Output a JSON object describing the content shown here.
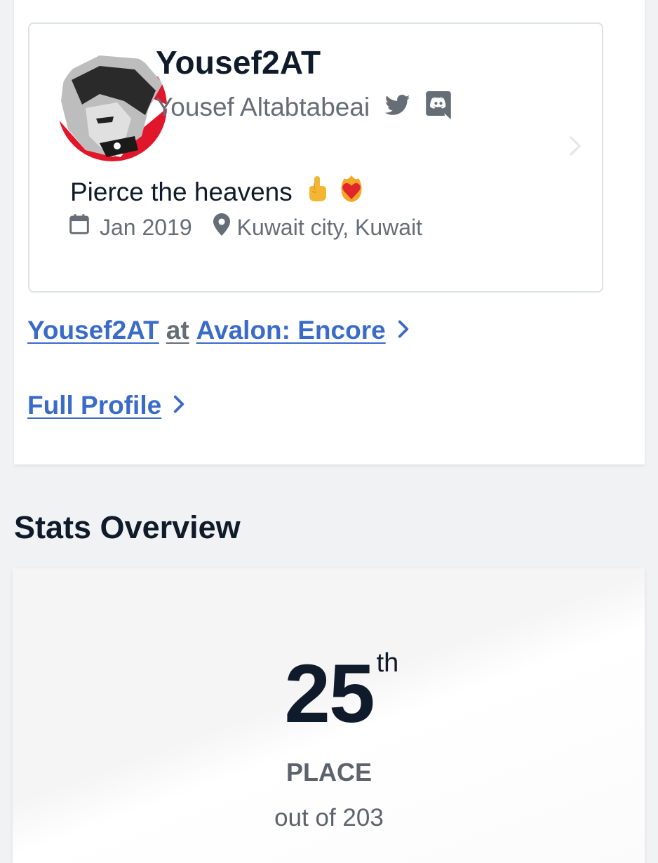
{
  "profile": {
    "username": "Yousef2AT",
    "full_name": "Yousef Altabtabeai",
    "bio_text": "Pierce the heavens",
    "bio_emojis": [
      "hand-index-up",
      "heart-on-fire"
    ],
    "joined": "Jan 2019",
    "location": "Kuwait city, Kuwait",
    "social": [
      "twitter-icon",
      "discord-icon"
    ]
  },
  "links": {
    "event_user": "Yousef2AT",
    "event_at": "at",
    "event_name": "Avalon: Encore",
    "full_profile": "Full Profile"
  },
  "stats": {
    "section_title": "Stats Overview",
    "rank": "25",
    "rank_suffix": "th",
    "place_label": "PLACE",
    "out_of": "out of 203"
  },
  "colors": {
    "link": "#3a6bc8",
    "heading": "#0f1b2a",
    "muted": "#666d76",
    "avatar_accent": "#e1162a"
  }
}
